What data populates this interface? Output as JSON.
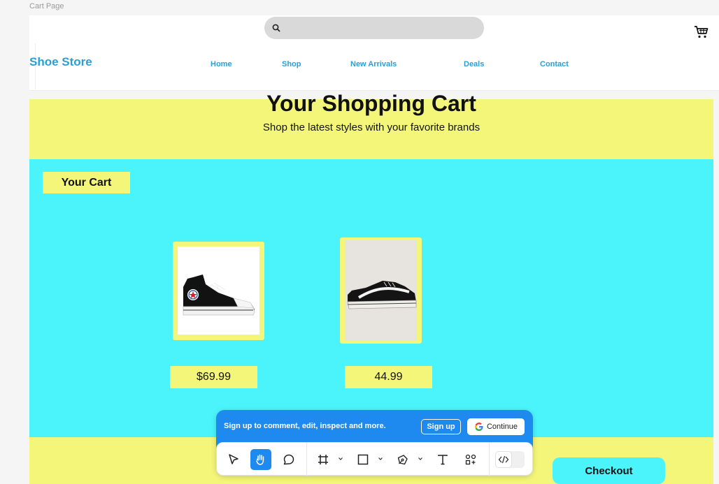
{
  "frame_label": "Cart Page",
  "header": {
    "brand": "Shoe Store",
    "search_placeholder": "",
    "nav": [
      "Home",
      "Shop",
      "New Arrivals",
      "Deals",
      "Contact"
    ]
  },
  "hero": {
    "title": "Your Shopping Cart",
    "subtitle": "Shop the latest styles with your favorite brands"
  },
  "cart": {
    "heading": "Your Cart",
    "items": [
      {
        "image": "black-high-top-sneaker",
        "price": "$69.99"
      },
      {
        "image": "black-low-top-skate-shoe",
        "price": "44.99"
      }
    ]
  },
  "checkout_label": "Checkout",
  "toolbar": {
    "banner_text": "Sign up to comment, edit, inspect and more.",
    "signup_label": "Sign up",
    "continue_label": "Continue",
    "tools": [
      "move-icon",
      "hand-icon",
      "comment-icon",
      "frame-icon",
      "rectangle-icon",
      "pen-icon",
      "text-icon",
      "components-icon",
      "code-icon"
    ]
  },
  "colors": {
    "yellow": "#f4f67a",
    "cyan": "#4bf4fb",
    "brand_blue": "#2a9fd6",
    "toolbar_blue": "#1e8af0"
  }
}
